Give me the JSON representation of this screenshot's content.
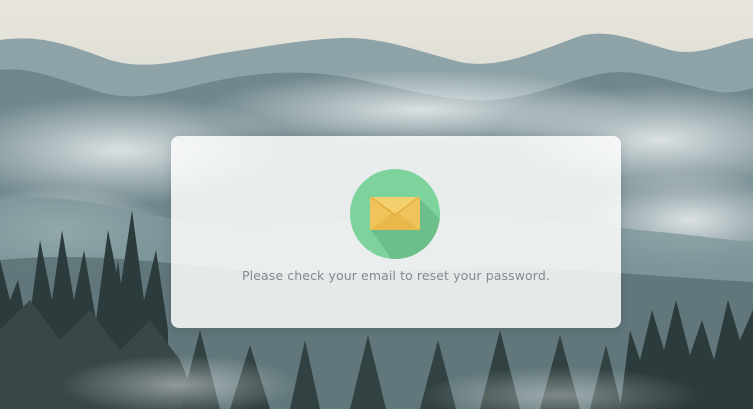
{
  "dialog": {
    "icon": "envelope-icon",
    "message": "Please check your email to reset your password."
  },
  "colors": {
    "icon_circle": "#7ed39c",
    "envelope": "#f0c45a",
    "message_text": "#858a8c"
  }
}
